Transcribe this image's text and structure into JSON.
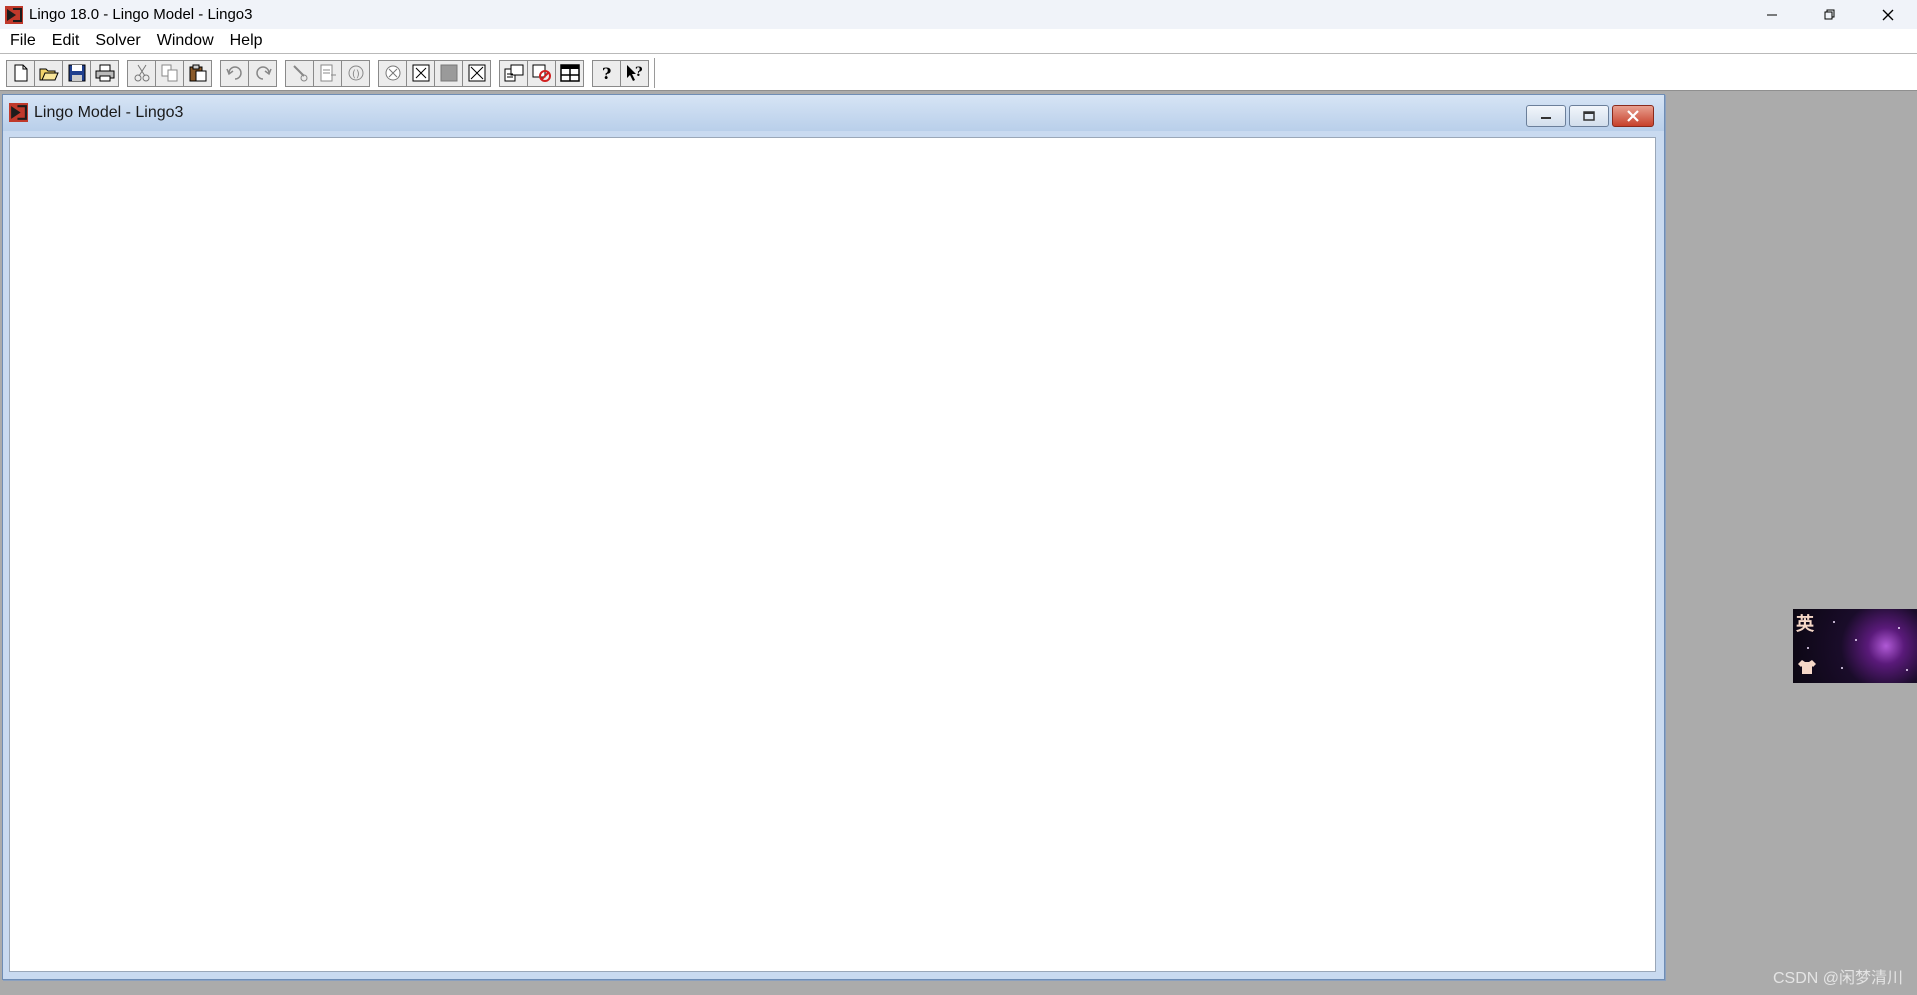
{
  "window": {
    "title": "Lingo 18.0 - Lingo Model - Lingo3",
    "app_icon": "lingo-app-icon",
    "controls": [
      "minimize-icon",
      "restore-icon",
      "close-icon"
    ]
  },
  "menu": {
    "items": [
      {
        "label": "File"
      },
      {
        "label": "Edit"
      },
      {
        "label": "Solver"
      },
      {
        "label": "Window"
      },
      {
        "label": "Help"
      }
    ]
  },
  "toolbar": {
    "groups": [
      [
        "new-file-icon",
        "open-folder-icon",
        "save-disk-icon",
        "print-icon"
      ],
      [
        "cut-icon",
        "copy-icon",
        "paste-icon"
      ],
      [
        "undo-icon",
        "redo-icon"
      ],
      [
        "find-icon",
        "goto-line-icon",
        "match-parenthesis-icon"
      ],
      [
        "solve-icon",
        "close-all-icon",
        "send-to-back-icon",
        "close-window-icon"
      ],
      [
        "options-icon",
        "generate-icon",
        "tile-windows-icon"
      ],
      [
        "help-topics-icon",
        "context-help-icon"
      ]
    ]
  },
  "model_window": {
    "title": "Lingo Model - Lingo3",
    "icon": "lingo-model-icon",
    "controls": [
      "child-minimize-icon",
      "child-maximize-icon",
      "child-close-icon"
    ],
    "content": ""
  },
  "side_widget": {
    "glyph": "英"
  },
  "watermark": {
    "text": "CSDN @闲梦清川"
  },
  "colors": {
    "mdi_background": "#ababab",
    "child_frame": "#c9daf0",
    "close_red": "#c7412b"
  }
}
